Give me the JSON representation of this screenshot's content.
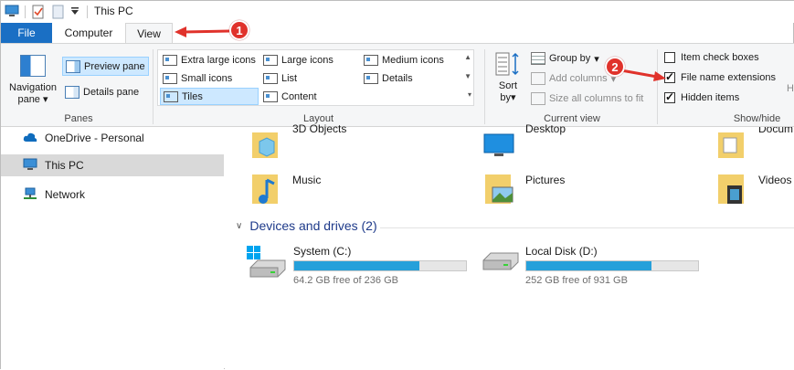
{
  "window": {
    "title": "This PC"
  },
  "tabs": {
    "file": "File",
    "computer": "Computer",
    "view": "View"
  },
  "panes_group": {
    "label": "Panes",
    "navigation_pane": "Navigation",
    "navigation_pane_2": "pane",
    "preview_pane": "Preview pane",
    "details_pane": "Details pane"
  },
  "layout_group": {
    "label": "Layout",
    "items": [
      "Extra large icons",
      "Large icons",
      "Medium icons",
      "Small icons",
      "List",
      "Details",
      "Tiles",
      "Content"
    ],
    "selected": "Tiles"
  },
  "current_view_group": {
    "label": "Current view",
    "sort": "Sort",
    "sort_by": "by",
    "group_by": "Group by",
    "add_columns": "Add columns",
    "size_columns": "Size all columns to fit"
  },
  "showhide_group": {
    "label": "Show/hide",
    "item_check_boxes": "Item check boxes",
    "file_name_extensions": "File name extensions",
    "hidden_items": "Hidden items",
    "item_check_boxes_checked": false,
    "file_name_extensions_checked": true,
    "hidden_items_checked": true,
    "cut_letter": "H"
  },
  "nav": {
    "onedrive": "OneDrive - Personal",
    "this_pc": "This PC",
    "network": "Network"
  },
  "folders": {
    "objects3d": "3D Objects",
    "desktop": "Desktop",
    "documents": "Docum",
    "music": "Music",
    "pictures": "Pictures",
    "videos": "Videos"
  },
  "devices": {
    "heading": "Devices and drives (2)",
    "drives": [
      {
        "name": "System (C:)",
        "free": "64.2 GB free of 236 GB",
        "used_fraction": 0.73
      },
      {
        "name": "Local Disk (D:)",
        "free": "252 GB free of 931 GB",
        "used_fraction": 0.73
      }
    ]
  },
  "annotations": {
    "marker1": "1",
    "marker2": "2"
  },
  "colors": {
    "accent": "#1a6fc4",
    "drive_fill": "#26a0da",
    "annotation": "#e0322b"
  }
}
